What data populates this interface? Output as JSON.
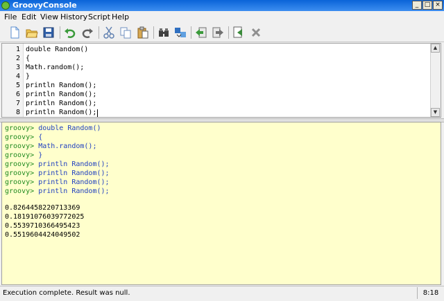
{
  "window": {
    "title": "GroovyConsole",
    "minimize": "_",
    "maximize": "□",
    "close": "×"
  },
  "menu": [
    "File",
    "Edit",
    "View",
    "History",
    "Script",
    "Help"
  ],
  "toolbar": [
    {
      "name": "new-file-icon",
      "color": "#5a8ed0"
    },
    {
      "name": "open-folder-icon",
      "color": "#e0b040"
    },
    {
      "name": "save-icon",
      "color": "#3060a8"
    },
    {
      "name": "undo-icon",
      "color": "#3a9a3a"
    },
    {
      "name": "redo-icon",
      "color": "#606060"
    },
    {
      "name": "cut-icon",
      "color": "#6080b0"
    },
    {
      "name": "copy-icon",
      "color": "#7090c0"
    },
    {
      "name": "paste-icon",
      "color": "#b08040"
    },
    {
      "name": "find-icon",
      "color": "#404040"
    },
    {
      "name": "replace-icon",
      "color": "#3070c0"
    },
    {
      "name": "history-back-icon",
      "color": "#3a9a3a"
    },
    {
      "name": "history-forward-icon",
      "color": "#707070"
    },
    {
      "name": "run-script-icon",
      "color": "#3a8a3a"
    },
    {
      "name": "interrupt-icon",
      "color": "#909090"
    }
  ],
  "editor": {
    "lines": [
      {
        "num": "1",
        "text": "double Random()"
      },
      {
        "num": "2",
        "text": "{"
      },
      {
        "num": "3",
        "text": "Math.random();"
      },
      {
        "num": "4",
        "text": "}"
      },
      {
        "num": "5",
        "text": "println Random();"
      },
      {
        "num": "6",
        "text": "println Random();"
      },
      {
        "num": "7",
        "text": "println Random();"
      },
      {
        "num": "8",
        "text": "println Random();"
      }
    ]
  },
  "output": {
    "prompt": "groovy>",
    "commands": [
      "double Random()",
      "{",
      "Math.random();",
      "}",
      "println Random();",
      "println Random();",
      "println Random();",
      "println Random();"
    ],
    "results": [
      "0.8264458220713369",
      "0.18191076039772025",
      "0.5539710366495423",
      "0.5519604424049502"
    ]
  },
  "status": {
    "message": "Execution complete. Result was null.",
    "position": "8:18"
  }
}
